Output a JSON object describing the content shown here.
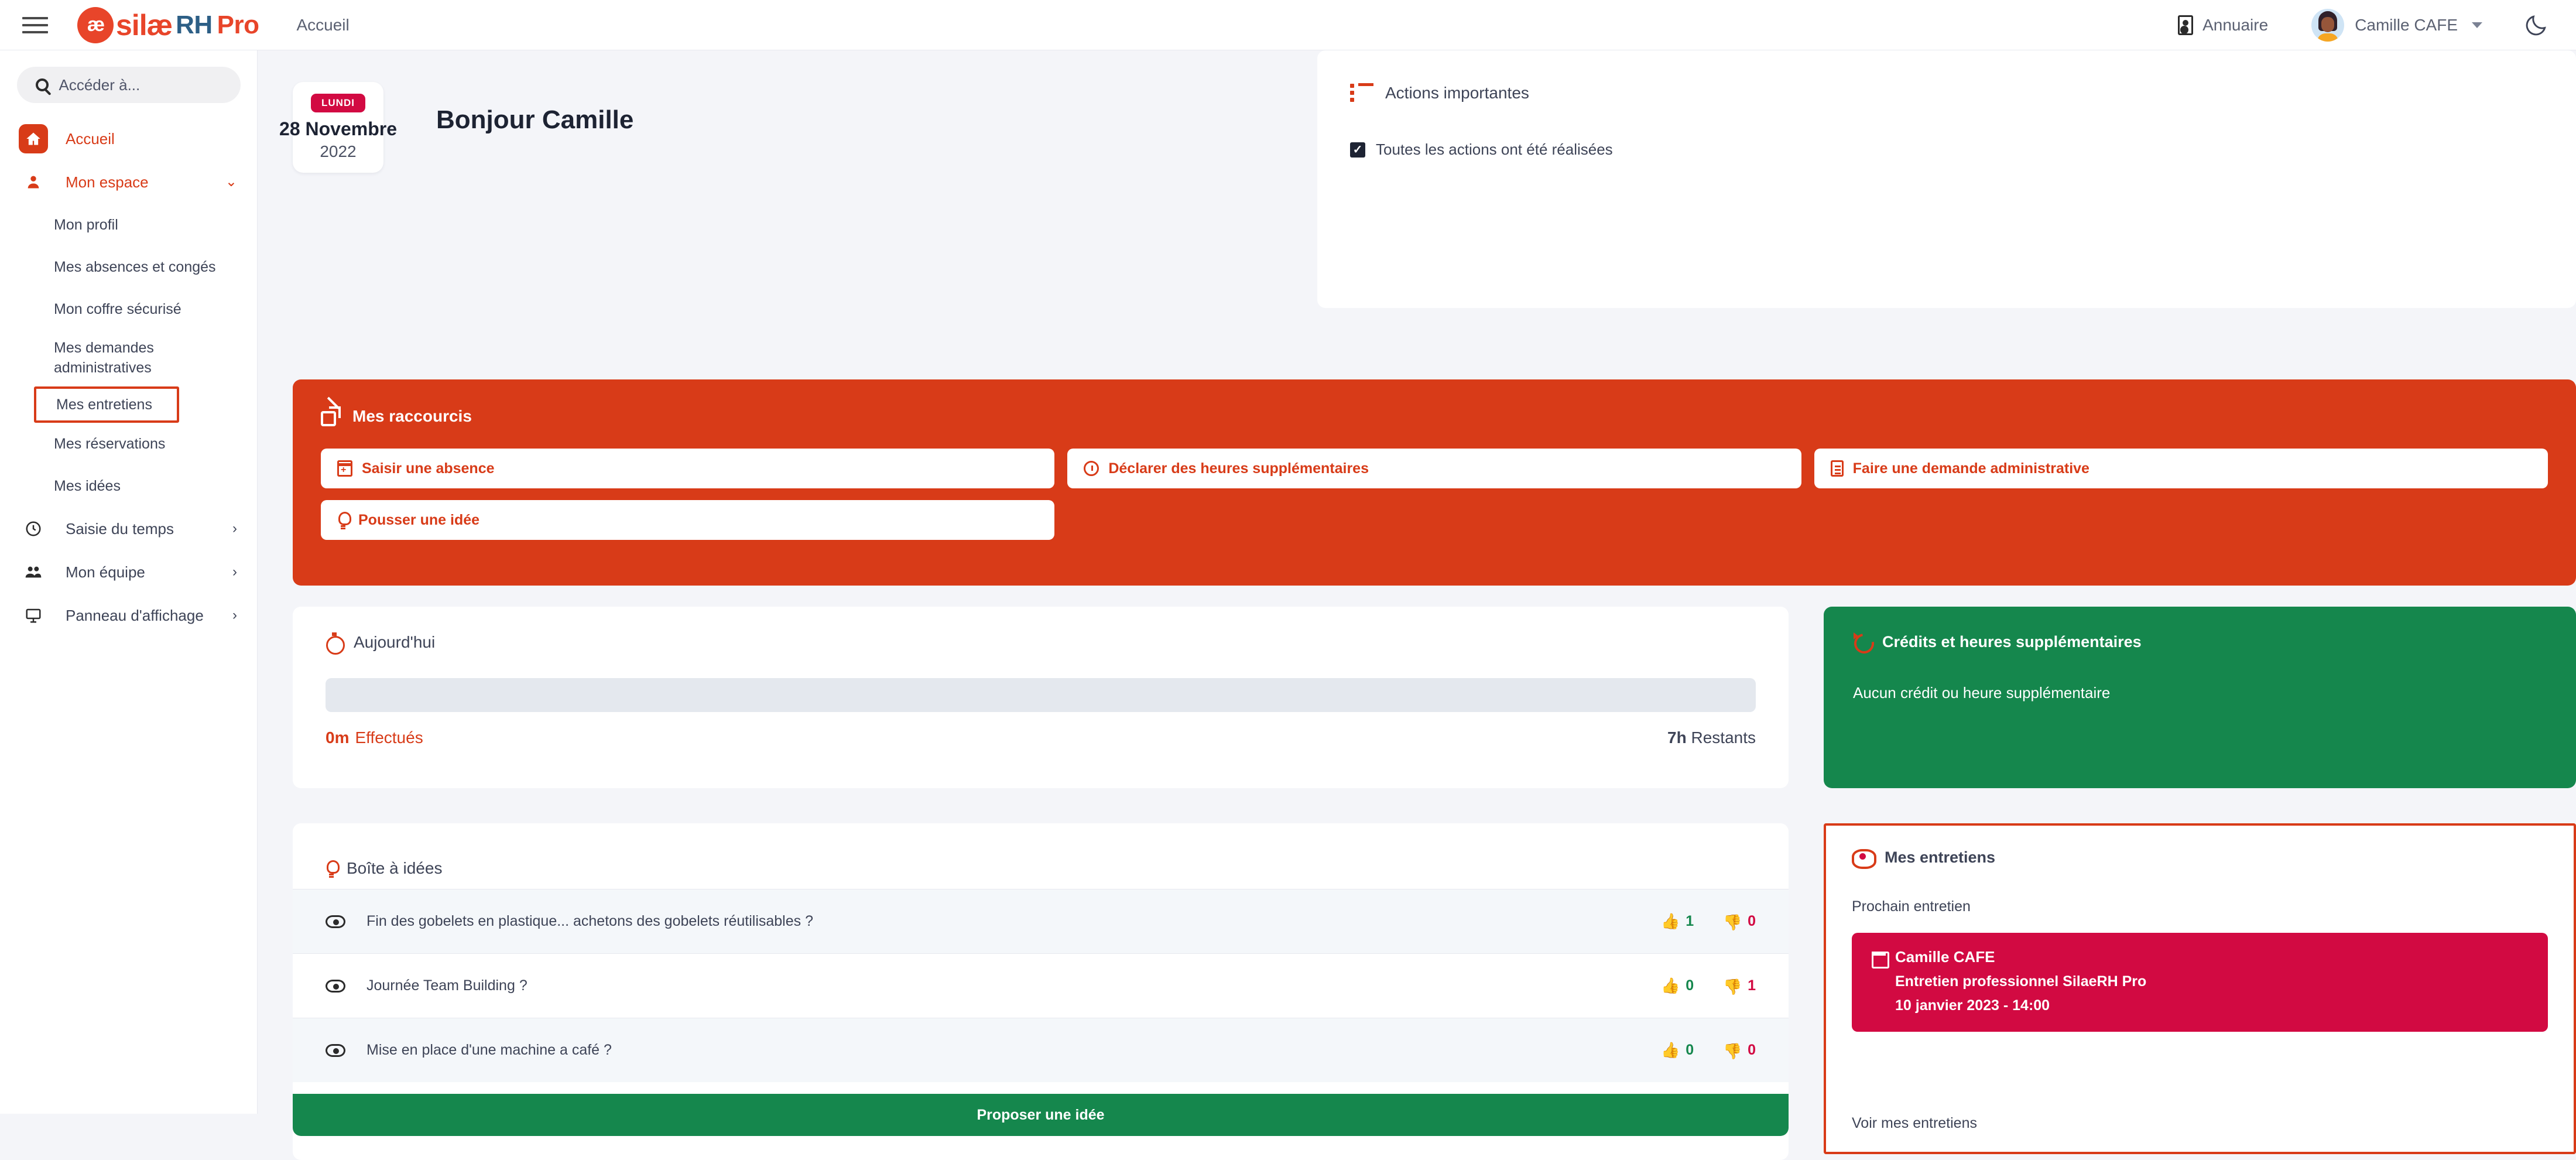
{
  "header": {
    "menu_icon": "hamburger-icon",
    "brand": {
      "mark": "æ",
      "sil": "silæ",
      "rh": "RH",
      "pro": "Pro"
    },
    "breadcrumb": "Accueil",
    "annuaire_label": "Annuaire",
    "user_name": "Camille CAFE",
    "theme_toggle_icon": "moon-icon"
  },
  "sidebar": {
    "search_placeholder": "Accéder à...",
    "items": [
      {
        "label": "Accueil",
        "icon": "home-icon",
        "active": true
      },
      {
        "label": "Mon espace",
        "icon": "user-icon",
        "chevron": "⌄"
      },
      {
        "label": "Mon profil"
      },
      {
        "label": "Mes absences et congés"
      },
      {
        "label": "Mon coffre sécurisé"
      },
      {
        "label": "Mes demandes administratives"
      },
      {
        "label": "Mes entretiens",
        "highlighted": true
      },
      {
        "label": "Mes réservations"
      },
      {
        "label": "Mes idées"
      },
      {
        "label": "Saisie du temps",
        "icon": "clock-icon",
        "chevron": "›"
      },
      {
        "label": "Mon équipe",
        "icon": "team-icon",
        "chevron": "›"
      },
      {
        "label": "Panneau d'affichage",
        "icon": "board-icon",
        "chevron": "›"
      }
    ]
  },
  "hero": {
    "day_badge": "LUNDI",
    "date_main": "28 Novembre",
    "date_year": "2022",
    "greeting": "Bonjour Camille"
  },
  "actions": {
    "title": "Actions importantes",
    "status_text": "Toutes les actions ont été réalisées"
  },
  "shortcuts": {
    "title": "Mes raccourcis",
    "items": [
      {
        "label": "Saisir une absence",
        "icon": "calendar-plus-icon"
      },
      {
        "label": "Déclarer des heures supplémentaires",
        "icon": "clock-history-icon"
      },
      {
        "label": "Faire une demande administrative",
        "icon": "document-icon"
      },
      {
        "label": "Pousser une idée",
        "icon": "lightbulb-icon"
      }
    ]
  },
  "today": {
    "title": "Aujourd'hui",
    "done_value": "0m",
    "done_label": "Effectués",
    "remaining_value": "7h",
    "remaining_label": "Restants",
    "progress_percent": 0
  },
  "credits": {
    "title": "Crédits et heures supplémentaires",
    "body": "Aucun crédit ou heure supplémentaire"
  },
  "ideas": {
    "title": "Boîte à idées",
    "rows": [
      {
        "text": "Fin des gobelets en plastique... achetons des gobelets réutilisables ?",
        "up": "1",
        "down": "0"
      },
      {
        "text": "Journée Team Building ?",
        "up": "0",
        "down": "1"
      },
      {
        "text": "Mise en place d'une machine a café ?",
        "up": "0",
        "down": "0"
      }
    ],
    "cta": "Proposer une idée"
  },
  "entretiens": {
    "title": "Mes entretiens",
    "subtitle": "Prochain entretien",
    "card": {
      "name": "Camille CAFE",
      "type": "Entretien professionnel SilaeRH Pro",
      "datetime": "10 janvier 2023 - 14:00"
    },
    "link": "Voir mes entretiens"
  },
  "colors": {
    "orange": "#d83b18",
    "green": "#15874d",
    "crimson": "#d20a42",
    "background": "#f4f5f9"
  }
}
